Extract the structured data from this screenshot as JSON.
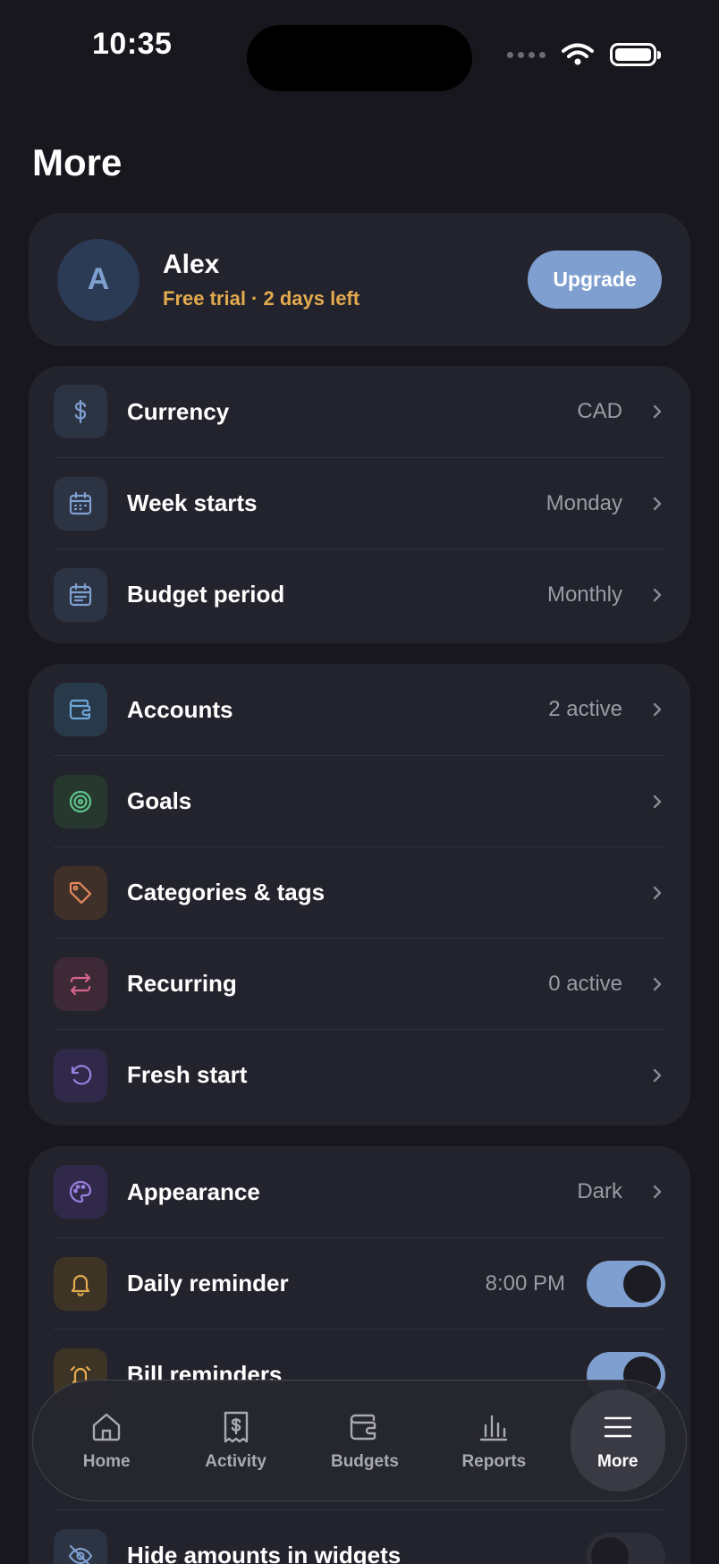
{
  "status_bar": {
    "time": "10:35"
  },
  "page": {
    "title": "More"
  },
  "profile": {
    "avatar_initial": "A",
    "name": "Alex",
    "subtitle": "Free trial · 2 days left",
    "upgrade_label": "Upgrade"
  },
  "settings_group": [
    {
      "label": "Currency",
      "value": "CAD",
      "icon": "dollar-icon"
    },
    {
      "label": "Week starts",
      "value": "Monday",
      "icon": "calendar-icon"
    },
    {
      "label": "Budget period",
      "value": "Monthly",
      "icon": "calendar-list-icon"
    }
  ],
  "data_group": [
    {
      "label": "Accounts",
      "value": "2 active",
      "icon": "wallet-icon"
    },
    {
      "label": "Goals",
      "value": "",
      "icon": "target-icon"
    },
    {
      "label": "Categories & tags",
      "value": "",
      "icon": "tag-icon"
    },
    {
      "label": "Recurring",
      "value": "0 active",
      "icon": "repeat-icon"
    },
    {
      "label": "Fresh start",
      "value": "",
      "icon": "undo-icon"
    }
  ],
  "prefs_group": [
    {
      "label": "Appearance",
      "value": "Dark",
      "icon": "palette-icon"
    },
    {
      "label": "Daily reminder",
      "value": "8:00 PM",
      "icon": "bell-icon",
      "toggle": true
    },
    {
      "label": "Bill reminders",
      "value": "",
      "icon": "alarm-icon",
      "toggle": true
    }
  ],
  "hidden_row": {
    "label": "Hide amounts in widgets",
    "icon": "eye-off-icon",
    "toggle": false
  },
  "tabbar": {
    "tabs": [
      {
        "label": "Home",
        "icon": "home-icon"
      },
      {
        "label": "Activity",
        "icon": "receipt-icon"
      },
      {
        "label": "Budgets",
        "icon": "wallet-icon"
      },
      {
        "label": "Reports",
        "icon": "bar-chart-icon"
      },
      {
        "label": "More",
        "icon": "menu-icon",
        "active": true
      }
    ]
  },
  "colors": {
    "background": "#17171d",
    "card": "#23232d",
    "accent": "#7e9fcf",
    "trial": "#e3aa4e"
  }
}
